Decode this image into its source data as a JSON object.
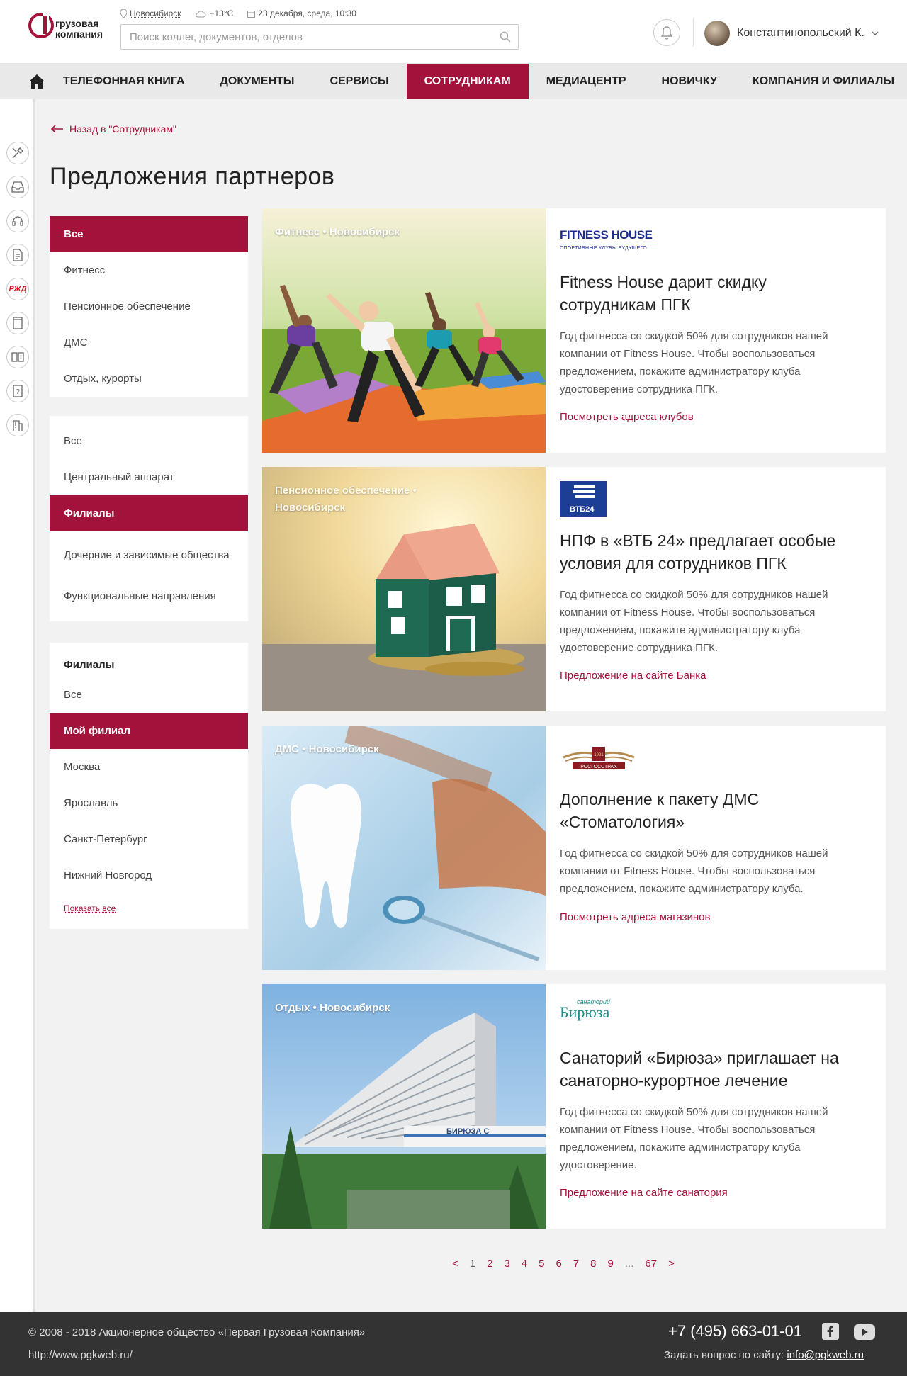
{
  "header": {
    "logo_line1": "грузовая",
    "logo_line2": "компания",
    "city": "Новосибирск",
    "weather": "−13°С",
    "date": "23 декабря, среда, 10:30",
    "search_placeholder": "Поиск коллег, документов, отделов",
    "user_name": "Константинопольский К."
  },
  "nav": {
    "items": [
      "ТЕЛЕФОННАЯ КНИГА",
      "ДОКУМЕНТЫ",
      "СЕРВИСЫ",
      "СОТРУДНИКАМ",
      "МЕДИАЦЕНТР",
      "НОВИЧКУ",
      "КОМПАНИЯ И ФИЛИАЛЫ"
    ],
    "active": "СОТРУДНИКАМ"
  },
  "rail": {
    "icons": [
      "tools-icon",
      "inbox-icon",
      "headset-icon",
      "document-icon",
      "rzd-icon",
      "book-icon",
      "wallet-icon",
      "help-icon",
      "building-icon"
    ],
    "rzd_text": "РЖД"
  },
  "page": {
    "back_label": "Назад в \"Сотрудникам\"",
    "title": "Предложения партнеров"
  },
  "filters": {
    "group1": [
      "Все",
      "Фитнесс",
      "Пенсионное обеспечение",
      "ДМС",
      "Отдых, курорты"
    ],
    "group2": [
      "Все",
      "Центральный аппарат",
      "Филиалы",
      "Дочерние и зависимые общества",
      "Функциональные направления"
    ],
    "group3_title": "Филиалы",
    "group3": [
      "Все",
      "Мой филиал",
      "Москва",
      "Ярославль",
      "Санкт-Петербург",
      "Нижний Новгород"
    ],
    "show_all": "Показать все"
  },
  "cards": [
    {
      "tag": "Фитнесс • Новосибирск",
      "logo_text": "FITNESS HOUSE",
      "logo_sub": "СПОРТИВНЫЕ КЛУБЫ БУДУЩЕГО",
      "title": "Fitness House дарит скидку сотрудникам ПГК",
      "text": "Год фитнесса со скидкой 50% для сотрудников нашей компании от Fitness House. Чтобы воспользоваться предложением, покажите администратору клуба удостоверение сотрудника ПГК.",
      "link": "Посмотреть адреса клубов"
    },
    {
      "tag": "Пенсионное обеспечение • Новосибирск",
      "logo_text": "ВТБ24",
      "title": "НПФ в «ВТБ 24» предлагает особые условия для сотрудников ПГК",
      "text": "Год фитнесса со скидкой 50% для сотрудников нашей компании от Fitness House. Чтобы воспользоваться предложением, покажите администратору клуба удостоверение сотрудника ПГК.",
      "link": "Предложение на сайте Банка"
    },
    {
      "tag": "ДМС • Новосибирск",
      "logo_text": "РОСГОССТРАХ",
      "logo_year": "1921",
      "title": "Дополнение к пакету ДМС «Стоматология»",
      "text": "Год фитнесса со скидкой 50% для сотрудников нашей компании от Fitness House. Чтобы воспользоваться предложением, покажите администратору клуба.",
      "link": "Посмотреть адреса магазинов"
    },
    {
      "tag": "Отдых • Новосибирск",
      "logo_text": "Бирюза",
      "logo_sub": "санаторий",
      "title": "Санаторий «Бирюза» приглашает на санаторно-курортное лечение",
      "text": "Год фитнесса со скидкой 50% для сотрудников нашей компании от Fitness House. Чтобы воспользоваться предложением, покажите администратору клуба удостоверение.",
      "link": "Предложение на сайте санатория",
      "building_sign": "БИРЮЗА С"
    }
  ],
  "pagination": [
    "<",
    "1",
    "2",
    "3",
    "4",
    "5",
    "6",
    "7",
    "8",
    "9",
    "...",
    "67",
    ">"
  ],
  "footer": {
    "copyright": "© 2008 - 2018 Акционерное общество «Первая Грузовая Компания»",
    "site": "http://www.pgkweb.ru/",
    "phone": "+7 (495) 663-01-01",
    "ask_label": "Задать вопрос по сайту:",
    "email": "info@pgkweb.ru"
  },
  "colors": {
    "accent": "#a3123a",
    "footer_bg": "#333333",
    "nav_bg": "#e9e9e9"
  }
}
